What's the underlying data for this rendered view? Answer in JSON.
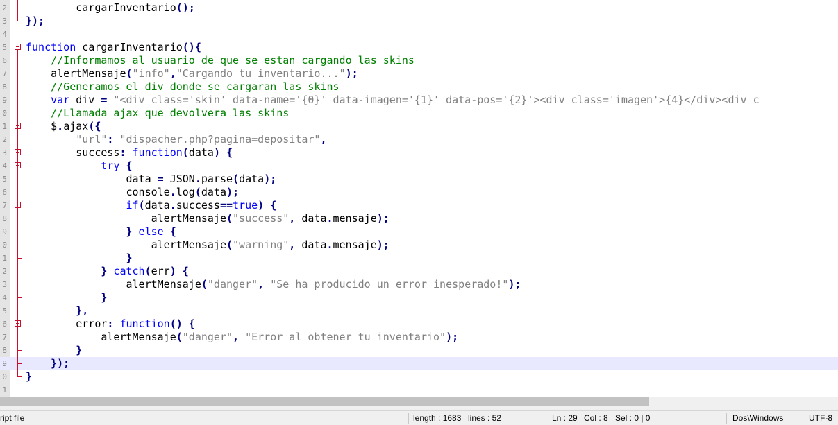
{
  "editor": {
    "first_line_number": 2,
    "current_line_index": 27,
    "lines": [
      {
        "n": "2",
        "t": [
          [
            "",
            "        cargarInventario"
          ],
          [
            "op",
            "();"
          ]
        ]
      },
      {
        "n": "3",
        "t": [
          [
            "op",
            "});"
          ]
        ]
      },
      {
        "n": "4",
        "t": []
      },
      {
        "n": "5",
        "t": [
          [
            "kw",
            "function"
          ],
          [
            "",
            " cargarInventario"
          ],
          [
            "op",
            "(){"
          ]
        ]
      },
      {
        "n": "6",
        "t": [
          [
            "cm",
            "    //Informamos al usuario de que se estan cargando las skins"
          ]
        ]
      },
      {
        "n": "7",
        "t": [
          [
            "",
            "    alertMensaje"
          ],
          [
            "op",
            "("
          ],
          [
            "st",
            "\"info\""
          ],
          [
            "op",
            ","
          ],
          [
            "st",
            "\"Cargando tu inventario...\""
          ],
          [
            "op",
            ");"
          ]
        ]
      },
      {
        "n": "8",
        "t": [
          [
            "cm",
            "    //Generamos el div donde se cargaran las skins"
          ]
        ]
      },
      {
        "n": "9",
        "t": [
          [
            "kw",
            "    var"
          ],
          [
            "",
            " div "
          ],
          [
            "op",
            "="
          ],
          [
            "st",
            " \"<div class='skin' data-name='{0}' data-imagen='{1}' data-pos='{2}'><div class='imagen'>{4}</div><div c"
          ]
        ]
      },
      {
        "n": "0",
        "t": [
          [
            "cm",
            "    //Llamada ajax que devolvera las skins"
          ]
        ]
      },
      {
        "n": "1",
        "t": [
          [
            "",
            "    $"
          ],
          [
            "op",
            "."
          ],
          [
            "",
            "ajax"
          ],
          [
            "op",
            "({"
          ]
        ]
      },
      {
        "n": "2",
        "t": [
          [
            "st",
            "        \"url\""
          ],
          [
            "op",
            ":"
          ],
          [
            "st",
            " \"dispacher.php?pagina=depositar\""
          ],
          [
            "op",
            ","
          ]
        ]
      },
      {
        "n": "3",
        "t": [
          [
            "",
            "        success"
          ],
          [
            "op",
            ":"
          ],
          [
            "kw",
            " function"
          ],
          [
            "op",
            "("
          ],
          [
            "",
            "data"
          ],
          [
            "op",
            ")"
          ],
          [
            "op",
            " {"
          ]
        ]
      },
      {
        "n": "4",
        "t": [
          [
            "kw",
            "            try"
          ],
          [
            "op",
            " {"
          ]
        ]
      },
      {
        "n": "5",
        "t": [
          [
            "",
            "                data "
          ],
          [
            "op",
            "="
          ],
          [
            "",
            " JSON"
          ],
          [
            "op",
            "."
          ],
          [
            "",
            "parse"
          ],
          [
            "op",
            "("
          ],
          [
            "",
            "data"
          ],
          [
            "op",
            ");"
          ]
        ]
      },
      {
        "n": "6",
        "t": [
          [
            "",
            "                console"
          ],
          [
            "op",
            "."
          ],
          [
            "",
            "log"
          ],
          [
            "op",
            "("
          ],
          [
            "",
            "data"
          ],
          [
            "op",
            ");"
          ]
        ]
      },
      {
        "n": "7",
        "t": [
          [
            "kw",
            "                if"
          ],
          [
            "op",
            "("
          ],
          [
            "",
            "data"
          ],
          [
            "op",
            "."
          ],
          [
            "",
            "success"
          ],
          [
            "op",
            "=="
          ],
          [
            "kw",
            "true"
          ],
          [
            "op",
            ")"
          ],
          [
            "op",
            " {"
          ]
        ]
      },
      {
        "n": "8",
        "t": [
          [
            "",
            "                    alertMensaje"
          ],
          [
            "op",
            "("
          ],
          [
            "st",
            "\"success\""
          ],
          [
            "op",
            ","
          ],
          [
            "",
            " data"
          ],
          [
            "op",
            "."
          ],
          [
            "",
            "mensaje"
          ],
          [
            "op",
            ");"
          ]
        ]
      },
      {
        "n": "9",
        "t": [
          [
            "op",
            "                }"
          ],
          [
            "kw",
            " else"
          ],
          [
            "op",
            " {"
          ]
        ]
      },
      {
        "n": "0",
        "t": [
          [
            "",
            "                    alertMensaje"
          ],
          [
            "op",
            "("
          ],
          [
            "st",
            "\"warning\""
          ],
          [
            "op",
            ","
          ],
          [
            "",
            " data"
          ],
          [
            "op",
            "."
          ],
          [
            "",
            "mensaje"
          ],
          [
            "op",
            ");"
          ]
        ]
      },
      {
        "n": "1",
        "t": [
          [
            "op",
            "                }"
          ]
        ]
      },
      {
        "n": "2",
        "t": [
          [
            "op",
            "            }"
          ],
          [
            "kw",
            " catch"
          ],
          [
            "op",
            "("
          ],
          [
            "",
            "err"
          ],
          [
            "op",
            ")"
          ],
          [
            "op",
            " {"
          ]
        ]
      },
      {
        "n": "3",
        "t": [
          [
            "",
            "                alertMensaje"
          ],
          [
            "op",
            "("
          ],
          [
            "st",
            "\"danger\""
          ],
          [
            "op",
            ","
          ],
          [
            "st",
            " \"Se ha producido un error inesperado!\""
          ],
          [
            "op",
            ");"
          ]
        ]
      },
      {
        "n": "4",
        "t": [
          [
            "op",
            "            }"
          ]
        ]
      },
      {
        "n": "5",
        "t": [
          [
            "op",
            "        },"
          ]
        ]
      },
      {
        "n": "6",
        "t": [
          [
            "",
            "        error"
          ],
          [
            "op",
            ":"
          ],
          [
            "kw",
            " function"
          ],
          [
            "op",
            "()"
          ],
          [
            "op",
            " {"
          ]
        ]
      },
      {
        "n": "7",
        "t": [
          [
            "",
            "            alertMensaje"
          ],
          [
            "op",
            "("
          ],
          [
            "st",
            "\"danger\""
          ],
          [
            "op",
            ","
          ],
          [
            "st",
            " \"Error al obtener tu inventario\""
          ],
          [
            "op",
            ");"
          ]
        ]
      },
      {
        "n": "8",
        "t": [
          [
            "op",
            "        }"
          ]
        ]
      },
      {
        "n": "9",
        "t": [
          [
            "op",
            "    });"
          ]
        ]
      },
      {
        "n": "0",
        "t": [
          [
            "op",
            "}"
          ]
        ]
      },
      {
        "n": "1",
        "t": []
      }
    ]
  },
  "statusbar": {
    "file_type": "ript file",
    "length": "length : 1683",
    "lines": "lines : 52",
    "ln": "Ln : 29",
    "col": "Col : 8",
    "sel": "Sel : 0 | 0",
    "eol": "Dos\\Windows",
    "encoding": "UTF-8"
  },
  "colors": {
    "keyword": "#0000ff",
    "string": "#808080",
    "comment": "#008000",
    "operator": "#000080",
    "current_line": "#e8e8ff",
    "fold_marker": "#c8102e"
  }
}
